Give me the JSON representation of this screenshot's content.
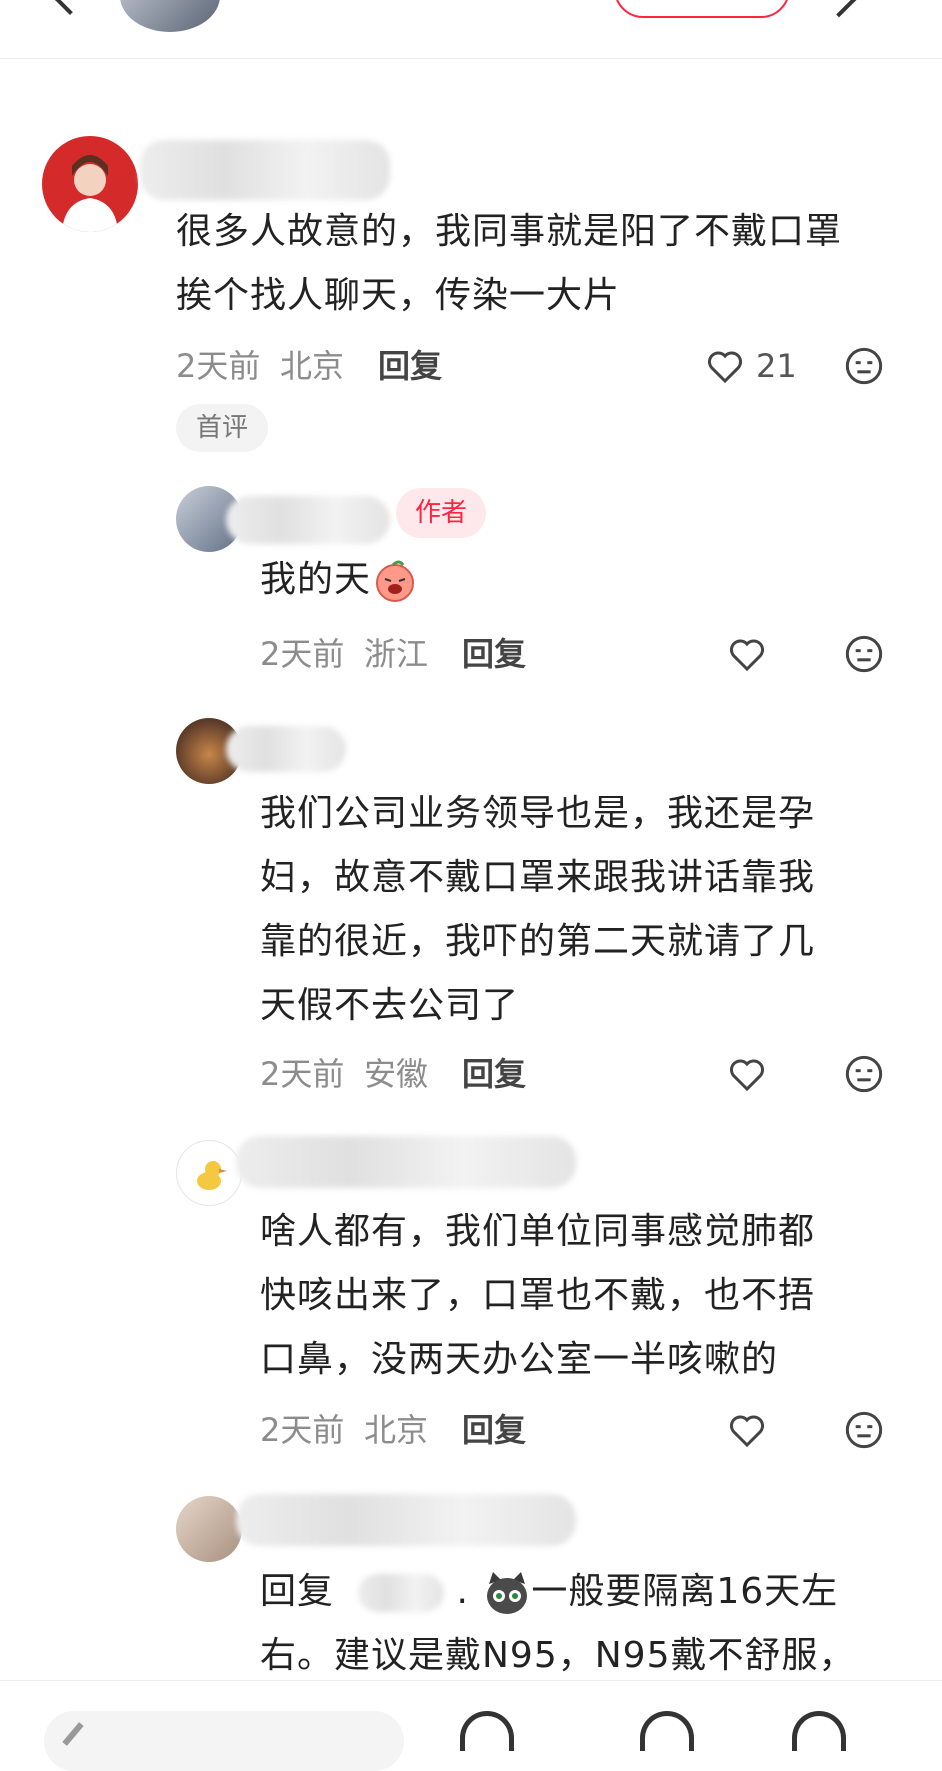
{
  "comments": [
    {
      "text_lines": [
        "很多人故意的，我同事就是阳了不戴口罩",
        "挨个找人聊天，传染一大片"
      ],
      "time": "2天前",
      "location": "北京",
      "reply_label": "回复",
      "likes": "21",
      "badge": "首评"
    },
    {
      "text": "我的天",
      "author_tag": "作者",
      "time": "2天前",
      "location": "浙江",
      "reply_label": "回复"
    },
    {
      "text_lines": [
        "我们公司业务领导也是，我还是孕",
        "妇，故意不戴口罩来跟我讲话靠我",
        "靠的很近，我吓的第二天就请了几",
        "天假不去公司了"
      ],
      "time": "2天前",
      "location": "安徽",
      "reply_label": "回复"
    },
    {
      "text_lines": [
        "啥人都有，我们单位同事感觉肺都",
        "快咳出来了，口罩也不戴，也不捂",
        "口鼻，没两天办公室一半咳嗽的"
      ],
      "time": "2天前",
      "location": "北京",
      "reply_label": "回复"
    },
    {
      "reply_prefix": "回复",
      "line1_tail": "一般要隔离16天左",
      "line2": "右。建议是戴N95，N95戴不舒服，"
    }
  ],
  "icons": {
    "like": "heart-outline-icon",
    "emoji": "neutral-face-icon"
  },
  "colors": {
    "accent": "#ff2442",
    "meta": "#8c8c8c"
  }
}
